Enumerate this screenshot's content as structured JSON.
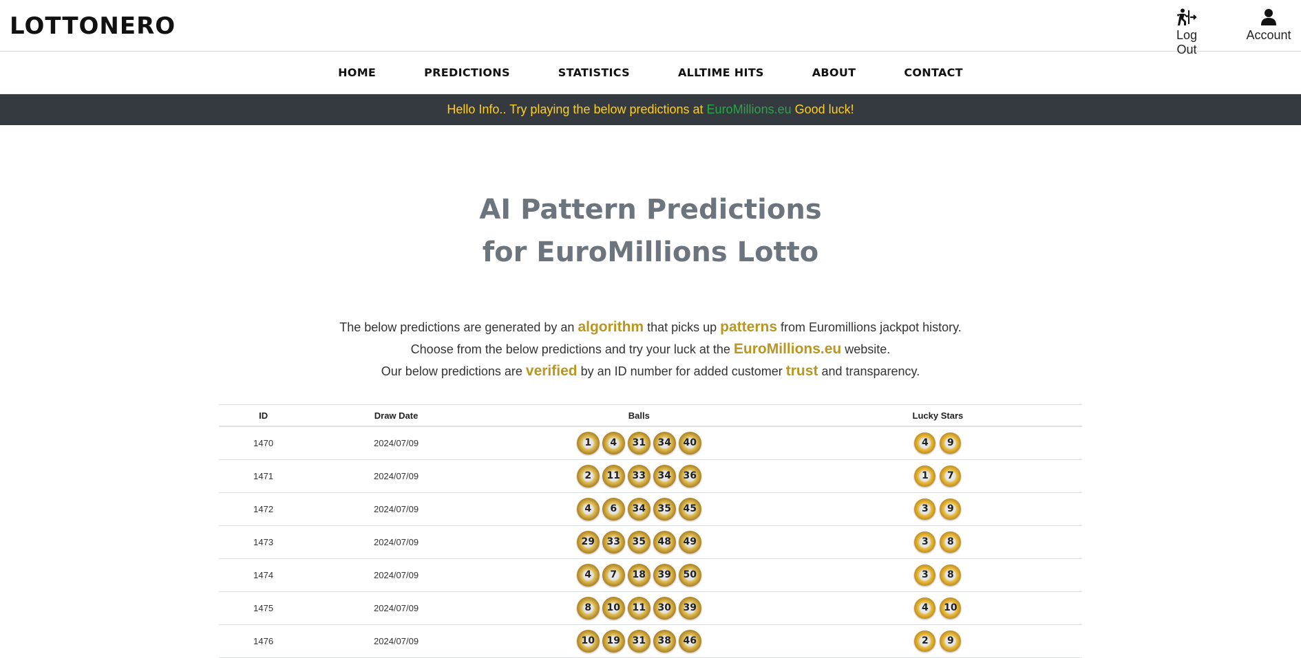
{
  "header": {
    "logo": "LOTTONERO",
    "logout_label": "Log Out",
    "account_label": "Account",
    "logout_icon": "exit-running-icon",
    "account_icon": "user-icon"
  },
  "nav": [
    "HOME",
    "PREDICTIONS",
    "STATISTICS",
    "ALLTIME HITS",
    "ABOUT",
    "CONTACT"
  ],
  "banner": {
    "before": "Hello Info.. Try playing the below predictions at ",
    "site": "EuroMillions.eu",
    "after": " Good luck!",
    "text_color": "#ffcf1f",
    "site_color": "#28a745",
    "bg_color": "#343a40"
  },
  "hero": {
    "line1": "AI Pattern Predictions",
    "line2": "for EuroMillions Lotto",
    "color": "#6c757d"
  },
  "intro": {
    "l1a": "The below predictions are generated by an ",
    "l1b": "algorithm",
    "l1c": " that picks up ",
    "l1d": "patterns",
    "l1e": " from Euromillions jackpot history.",
    "l2a": "Choose from the below predictions and try your luck at the ",
    "l2b": "EuroMillions.eu",
    "l2c": " website.",
    "l3a": "Our below predictions are ",
    "l3b": "verified",
    "l3c": " by an ID number for added customer ",
    "l3d": "trust",
    "l3e": " and transparency.",
    "highlight_color": "#b8961f"
  },
  "table": {
    "headers": [
      "ID",
      "Draw Date",
      "Balls",
      "Lucky Stars"
    ],
    "rows": [
      {
        "id": "1470",
        "date": "2024/07/09",
        "balls": [
          "1",
          "4",
          "31",
          "34",
          "40"
        ],
        "stars": [
          "4",
          "9"
        ]
      },
      {
        "id": "1471",
        "date": "2024/07/09",
        "balls": [
          "2",
          "11",
          "33",
          "34",
          "36"
        ],
        "stars": [
          "1",
          "7"
        ]
      },
      {
        "id": "1472",
        "date": "2024/07/09",
        "balls": [
          "4",
          "6",
          "34",
          "35",
          "45"
        ],
        "stars": [
          "3",
          "9"
        ]
      },
      {
        "id": "1473",
        "date": "2024/07/09",
        "balls": [
          "29",
          "33",
          "35",
          "48",
          "49"
        ],
        "stars": [
          "3",
          "8"
        ]
      },
      {
        "id": "1474",
        "date": "2024/07/09",
        "balls": [
          "4",
          "7",
          "18",
          "39",
          "50"
        ],
        "stars": [
          "3",
          "8"
        ]
      },
      {
        "id": "1475",
        "date": "2024/07/09",
        "balls": [
          "8",
          "10",
          "11",
          "30",
          "39"
        ],
        "stars": [
          "4",
          "10"
        ]
      },
      {
        "id": "1476",
        "date": "2024/07/09",
        "balls": [
          "10",
          "19",
          "31",
          "38",
          "46"
        ],
        "stars": [
          "2",
          "9"
        ]
      }
    ]
  }
}
